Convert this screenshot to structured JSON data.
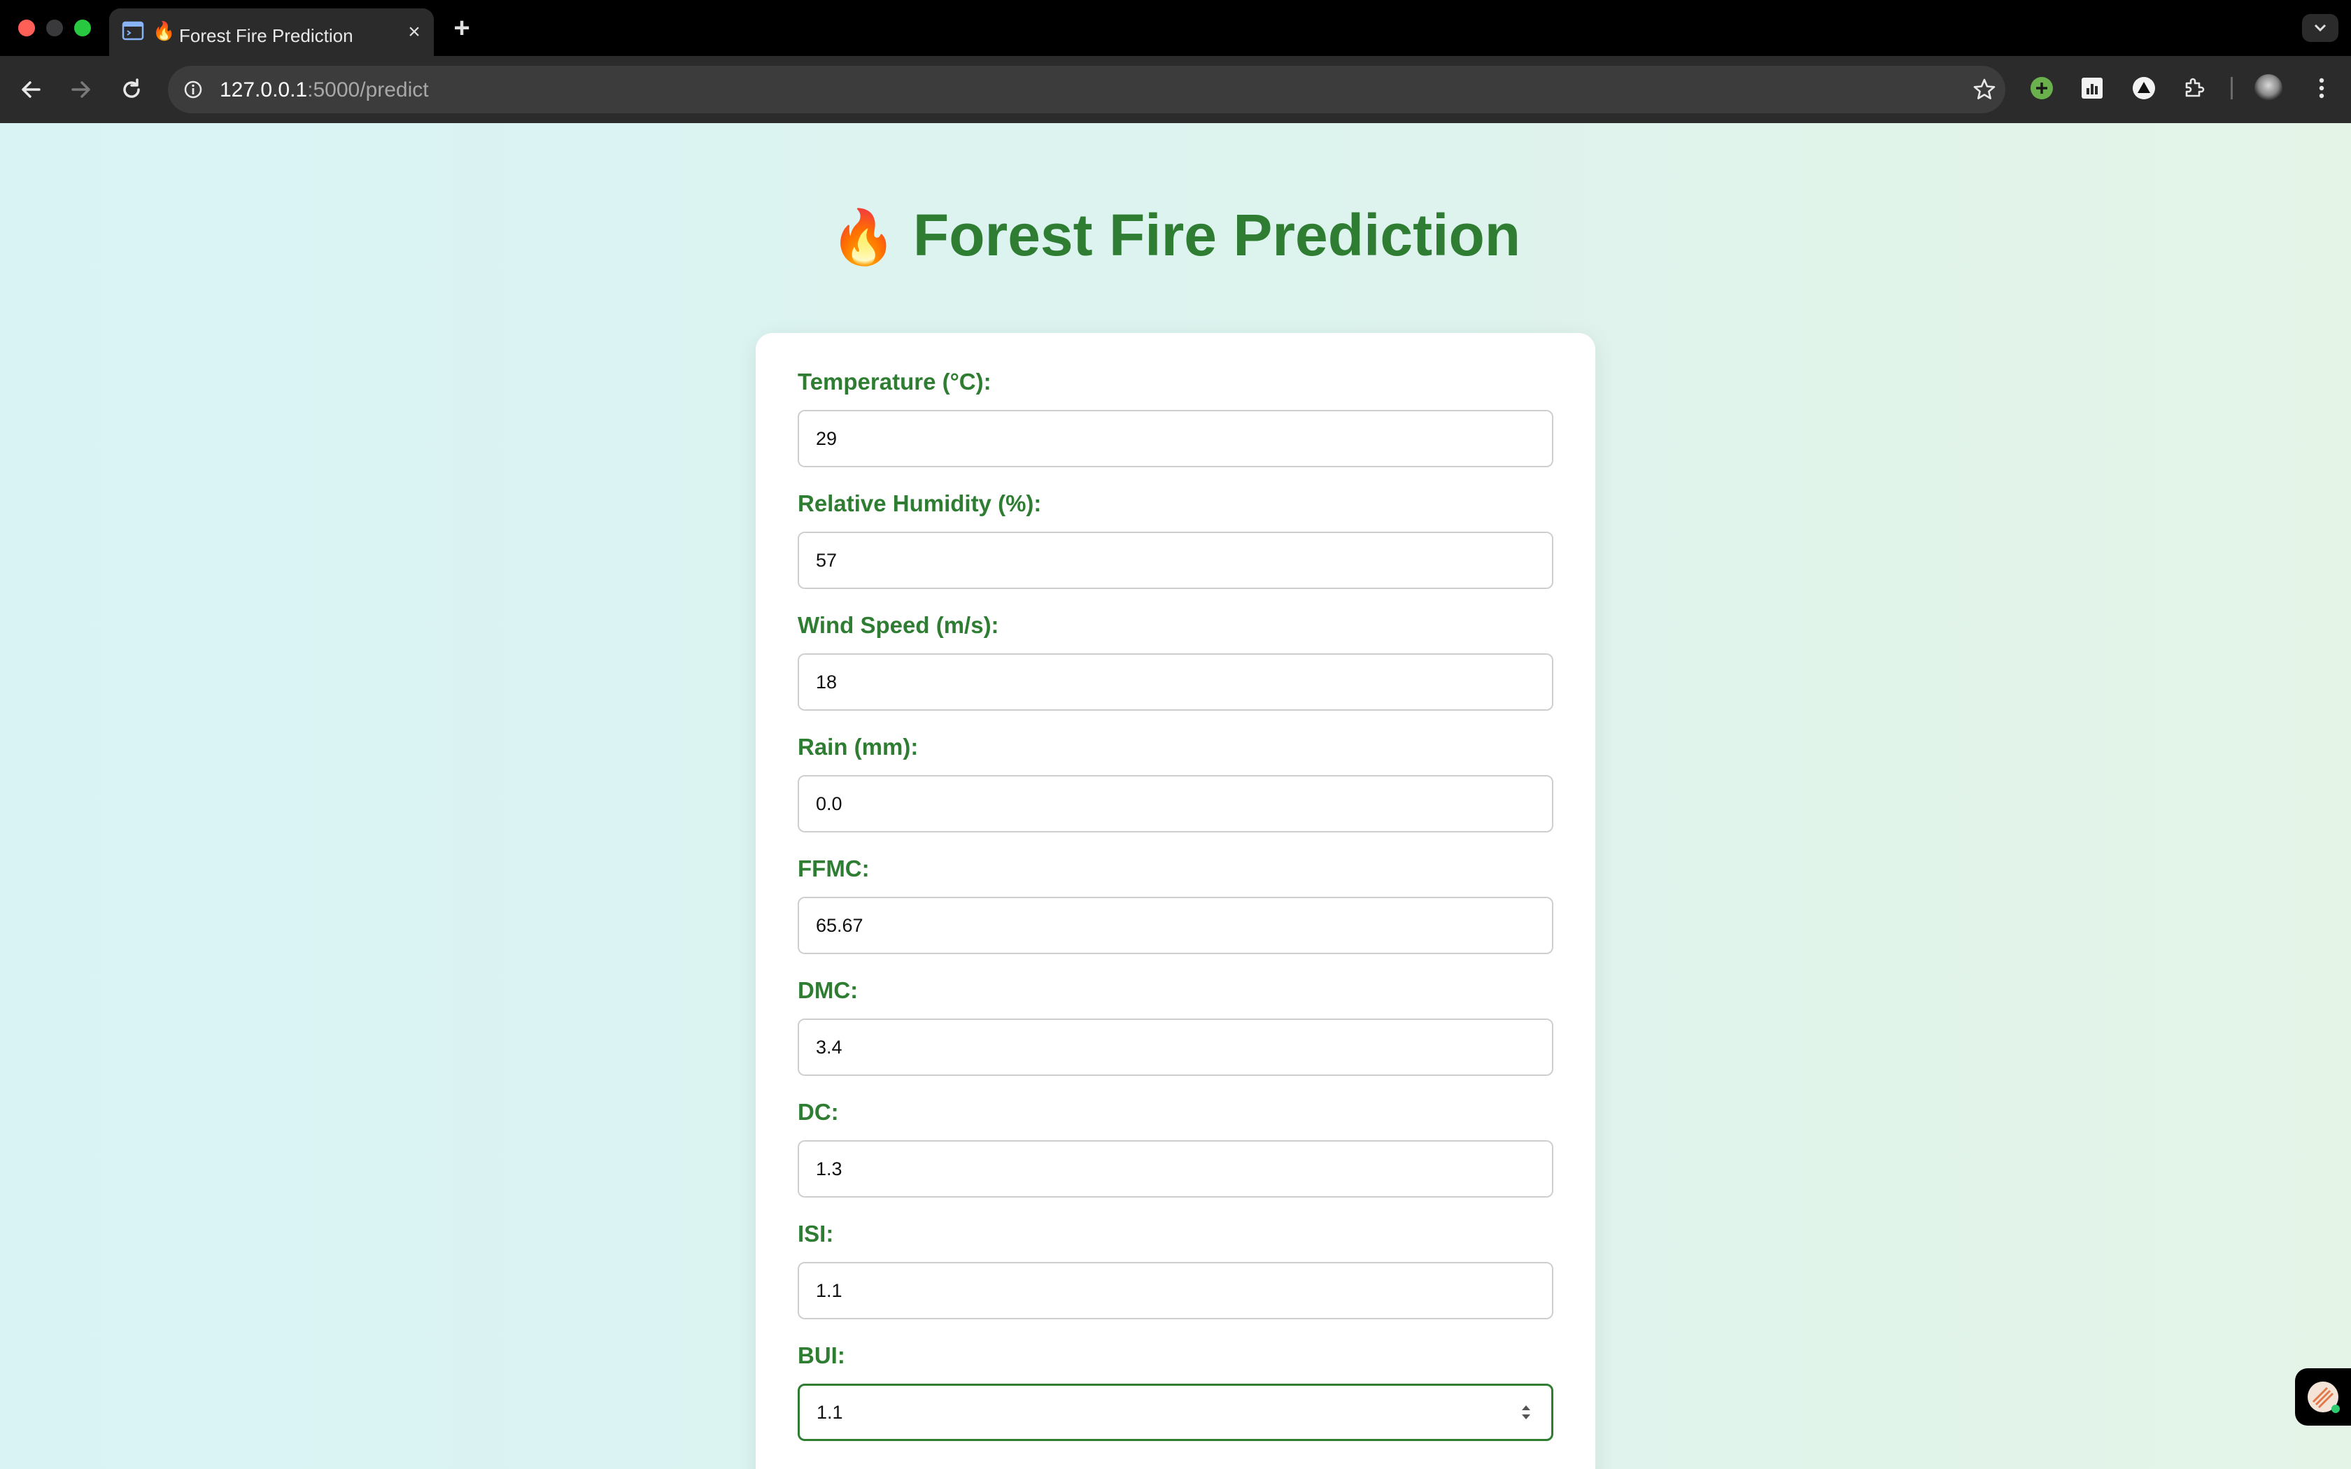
{
  "browser": {
    "tab": {
      "favicon": "🔥",
      "title": "Forest Fire Prediction"
    },
    "url": {
      "host": "127.0.0.1",
      "path": ":5000/predict"
    }
  },
  "page": {
    "title_icon": "🔥",
    "title": "Forest Fire Prediction"
  },
  "form": {
    "fields": [
      {
        "label": "Temperature (°C):",
        "value": "29"
      },
      {
        "label": "Relative Humidity (%):",
        "value": "57"
      },
      {
        "label": "Wind Speed (m/s):",
        "value": "18"
      },
      {
        "label": "Rain (mm):",
        "value": "0.0"
      },
      {
        "label": "FFMC:",
        "value": "65.67"
      },
      {
        "label": "DMC:",
        "value": "3.4"
      },
      {
        "label": "DC:",
        "value": "1.3"
      },
      {
        "label": "ISI:",
        "value": "1.1"
      },
      {
        "label": "BUI:",
        "value": "1.1"
      }
    ]
  },
  "colors": {
    "accent": "#2e7d32",
    "background_start": "#d9f3f5",
    "background_end": "#e4f4e7"
  }
}
